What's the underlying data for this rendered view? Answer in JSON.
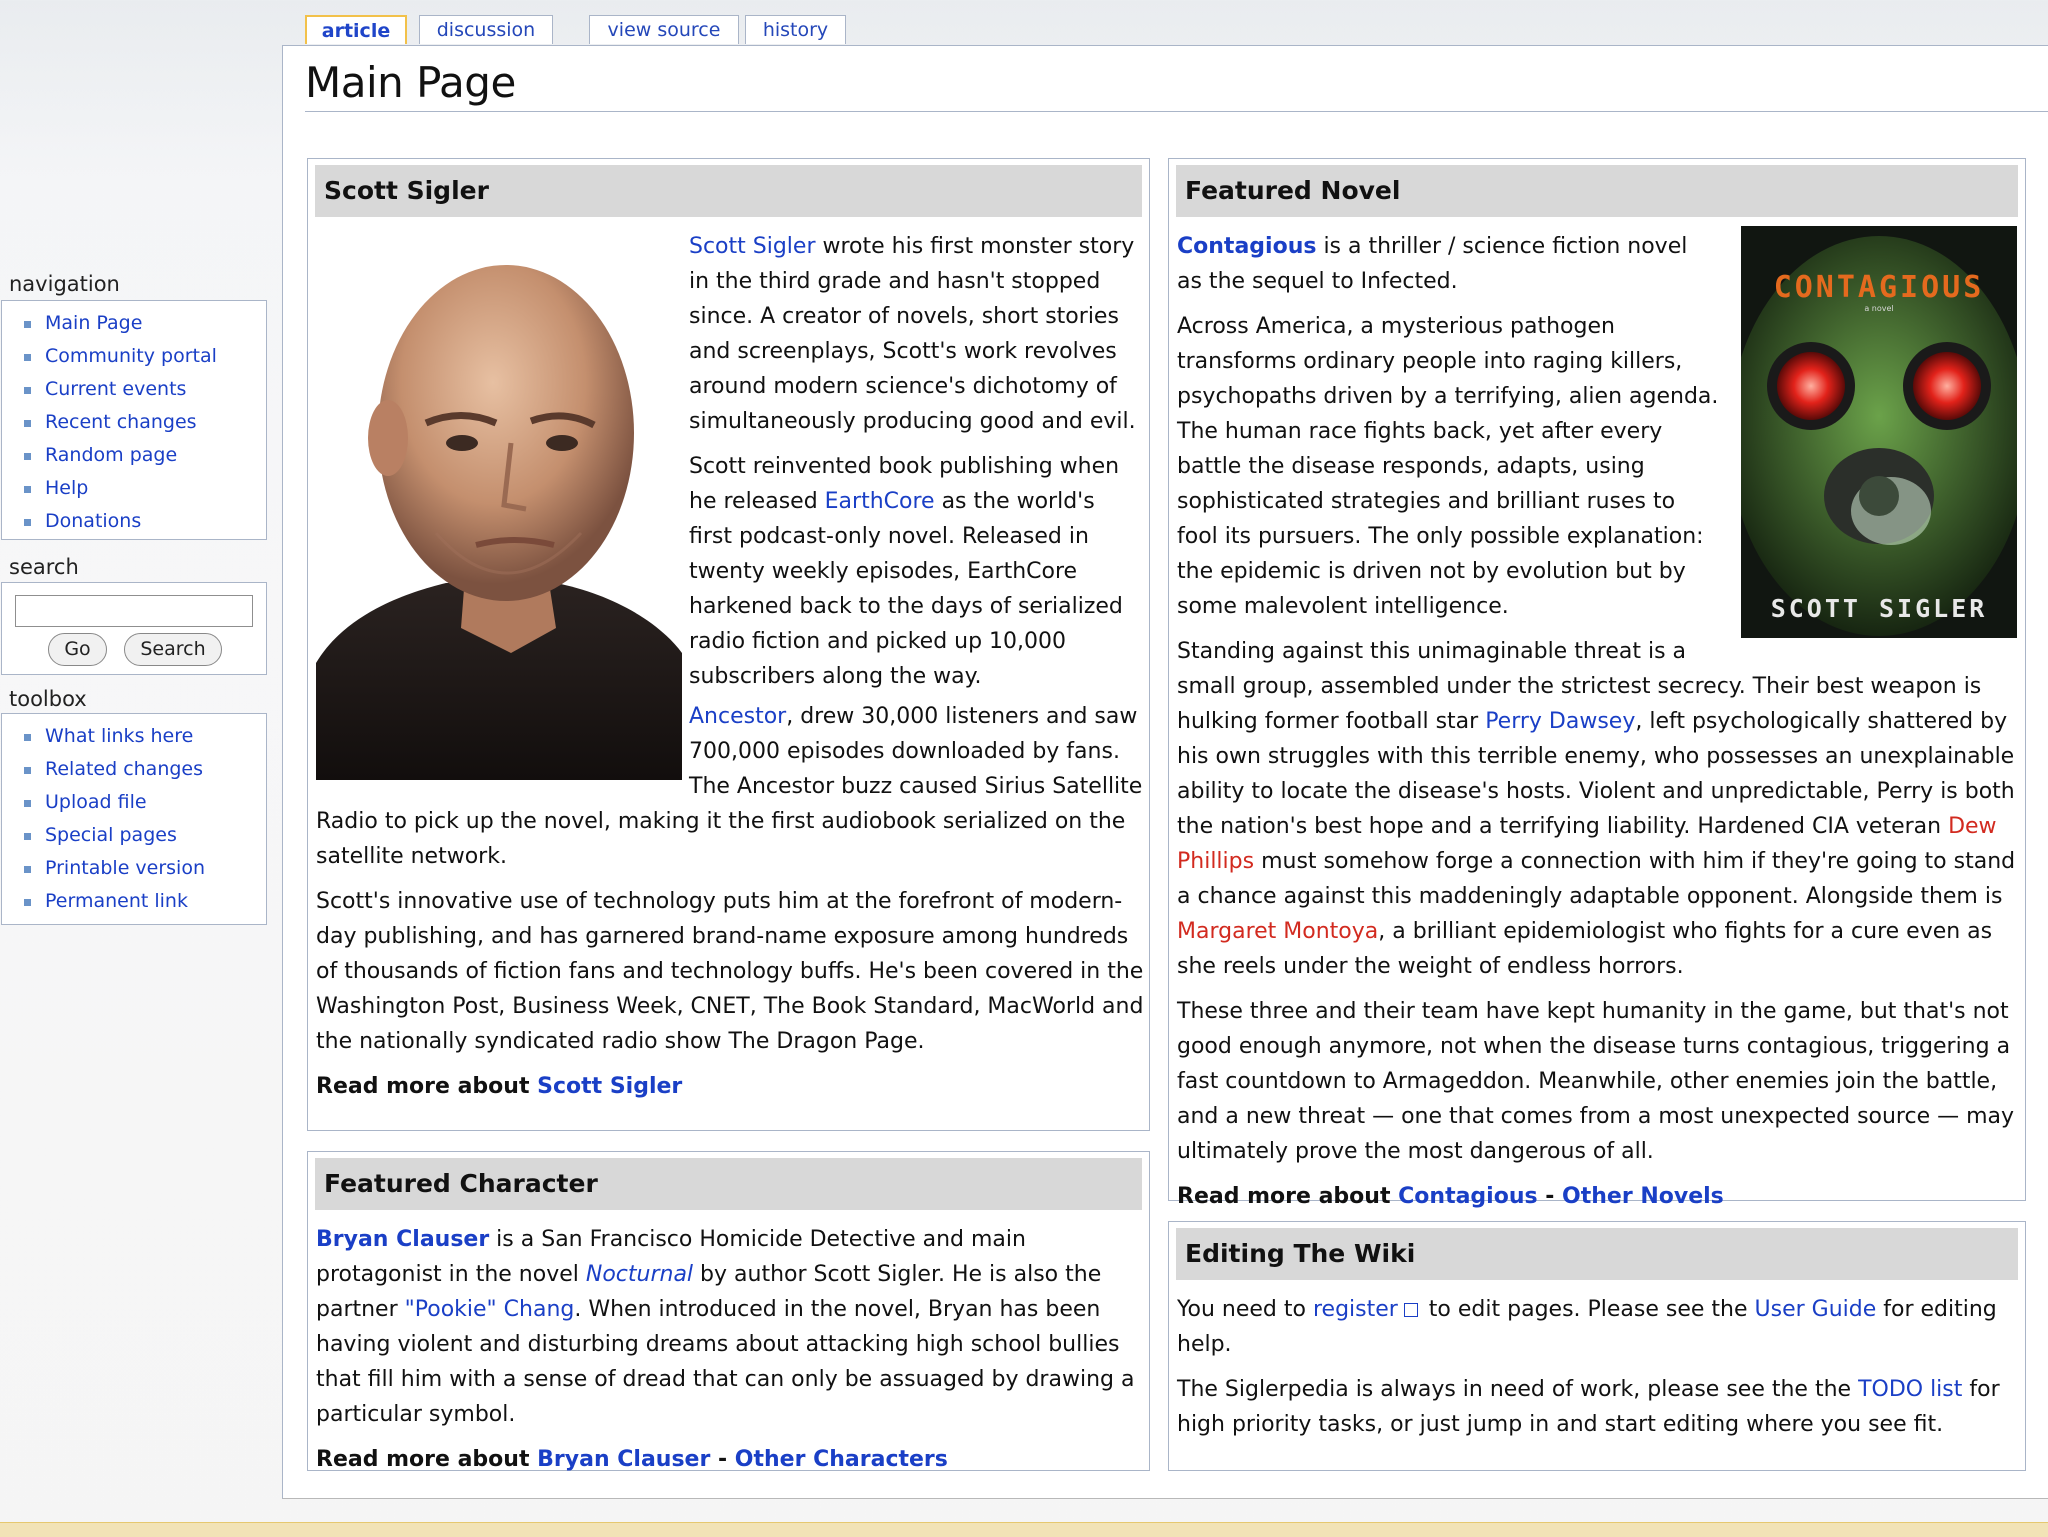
{
  "tabs": {
    "article": "article",
    "discussion": "discussion",
    "view_source": "view source",
    "history": "history"
  },
  "page": {
    "title": "Main Page"
  },
  "sidebar": {
    "navigation": {
      "title": "navigation",
      "items": [
        "Main Page",
        "Community portal",
        "Current events",
        "Recent changes",
        "Random page",
        "Help",
        "Donations"
      ]
    },
    "search": {
      "title": "search",
      "go": "Go",
      "search": "Search",
      "value": ""
    },
    "toolbox": {
      "title": "toolbox",
      "items": [
        "What links here",
        "Related changes",
        "Upload file",
        "Special pages",
        "Printable version",
        "Permanent link"
      ]
    }
  },
  "scott": {
    "header": "Scott Sigler",
    "p1_link": "Scott Sigler",
    "p1_rest": " wrote his first monster story in the third grade and hasn't stopped since. A creator of novels, short stories and screenplays, Scott's work revolves around modern science's dichotomy of simultaneously producing good and evil.",
    "p2_a": "Scott reinvented book publishing when he released ",
    "p2_link": "EarthCore",
    "p2_b": " as the world's first podcast-only novel. Released in twenty weekly episodes, EarthCore harkened back to the days of serialized radio fiction and picked up 10,000 subscribers along the way.",
    "p3_link": "Ancestor",
    "p3_rest": ", drew 30,000 listeners and saw 700,000 episodes downloaded by fans. The Ancestor buzz caused Sirius Satellite Radio to pick up the novel, making it the first audiobook serialized on the satellite network.",
    "p4": "Scott's innovative use of technology puts him at the forefront of modern-day publishing, and has garnered brand-name exposure among hundreds of thousands of fiction fans and technology buffs. He's been covered in the Washington Post, Business Week, CNET, The Book Standard, MacWorld and the nationally syndicated radio show The Dragon Page.",
    "read_more": "Read more about ",
    "read_more_link": "Scott Sigler"
  },
  "character": {
    "header": "Featured Character",
    "name_link": "Bryan Clauser",
    "t1": " is a San Francisco Homicide Detective and main protagonist in the novel ",
    "novel_link": "Nocturnal",
    "t2": " by author Scott Sigler. He is also the partner ",
    "pookie_link": "\"Pookie\" Chang",
    "t3": ". When introduced in the novel, Bryan has been having violent and disturbing dreams about attacking high school bullies that fill him with a sense of dread that can only be assuaged by drawing a particular symbol.",
    "read_more": "Read more about ",
    "read_more_link": "Bryan Clauser",
    "sep": " - ",
    "other_link": "Other Characters"
  },
  "novel": {
    "header": "Featured Novel",
    "title_link": "Contagious",
    "p1_rest": " is a thriller / science fiction novel as the sequel to Infected.",
    "p2": "Across America, a mysterious pathogen transforms ordinary people into raging killers, psychopaths driven by a terrifying, alien agenda. The human race fights back, yet after every battle the disease responds, adapts, using sophisticated strategies and brilliant ruses to fool its pursuers. The only possible explanation: the epidemic is driven not by evolution but by some malevolent intelligence.",
    "p3_a": "Standing against this unimaginable threat is a small group, assembled under the strictest secrecy. Their best weapon is hulking former football star ",
    "perry_link": "Perry Dawsey",
    "p3_b": ", left psychologically shattered by his own struggles with this terrible enemy, who possesses an unexplainable ability to locate the disease's hosts. Violent and unpredictable, Perry is both the nation's best hope and a terrifying liability. Hardened CIA veteran ",
    "dew_link": "Dew Phillips",
    "p3_c": " must somehow forge a connection with him if they're going to stand a chance against this maddeningly adaptable opponent. Alongside them is ",
    "margaret_link": "Margaret Montoya",
    "p3_d": ", a brilliant epidemiologist who fights for a cure even as she reels under the weight of endless horrors.",
    "p4": "These three and their team have kept humanity in the game, but that's not good enough anymore, not when the disease turns contagious, triggering a fast countdown to Armageddon. Meanwhile, other enemies join the battle, and a new threat — one that comes from a most unexpected source — may ultimately prove the most dangerous of all.",
    "read_more": "Read more about ",
    "read_more_link": "Contagious",
    "sep": " - ",
    "other_link": "Other Novels",
    "cover_title": "CONTAGIOUS",
    "cover_sub": "a novel",
    "cover_author": "SCOTT SIGLER"
  },
  "editing": {
    "header": "Editing The Wiki",
    "p1_a": "You need to ",
    "register_link": "register",
    "p1_b": " to edit pages. Please see the ",
    "guide_link": "User Guide",
    "p1_c": " for editing help.",
    "p2_a": "The Siglerpedia is always in need of work, please see the the ",
    "todo_link": "TODO list",
    "p2_b": " for high priority tasks, or just jump in and start editing where you see fit."
  },
  "colors": {
    "link": "#1a3fc6",
    "redlink": "#d22a1f",
    "header_bg": "#d8d8d8",
    "tab_selected": "#f2c14a"
  }
}
